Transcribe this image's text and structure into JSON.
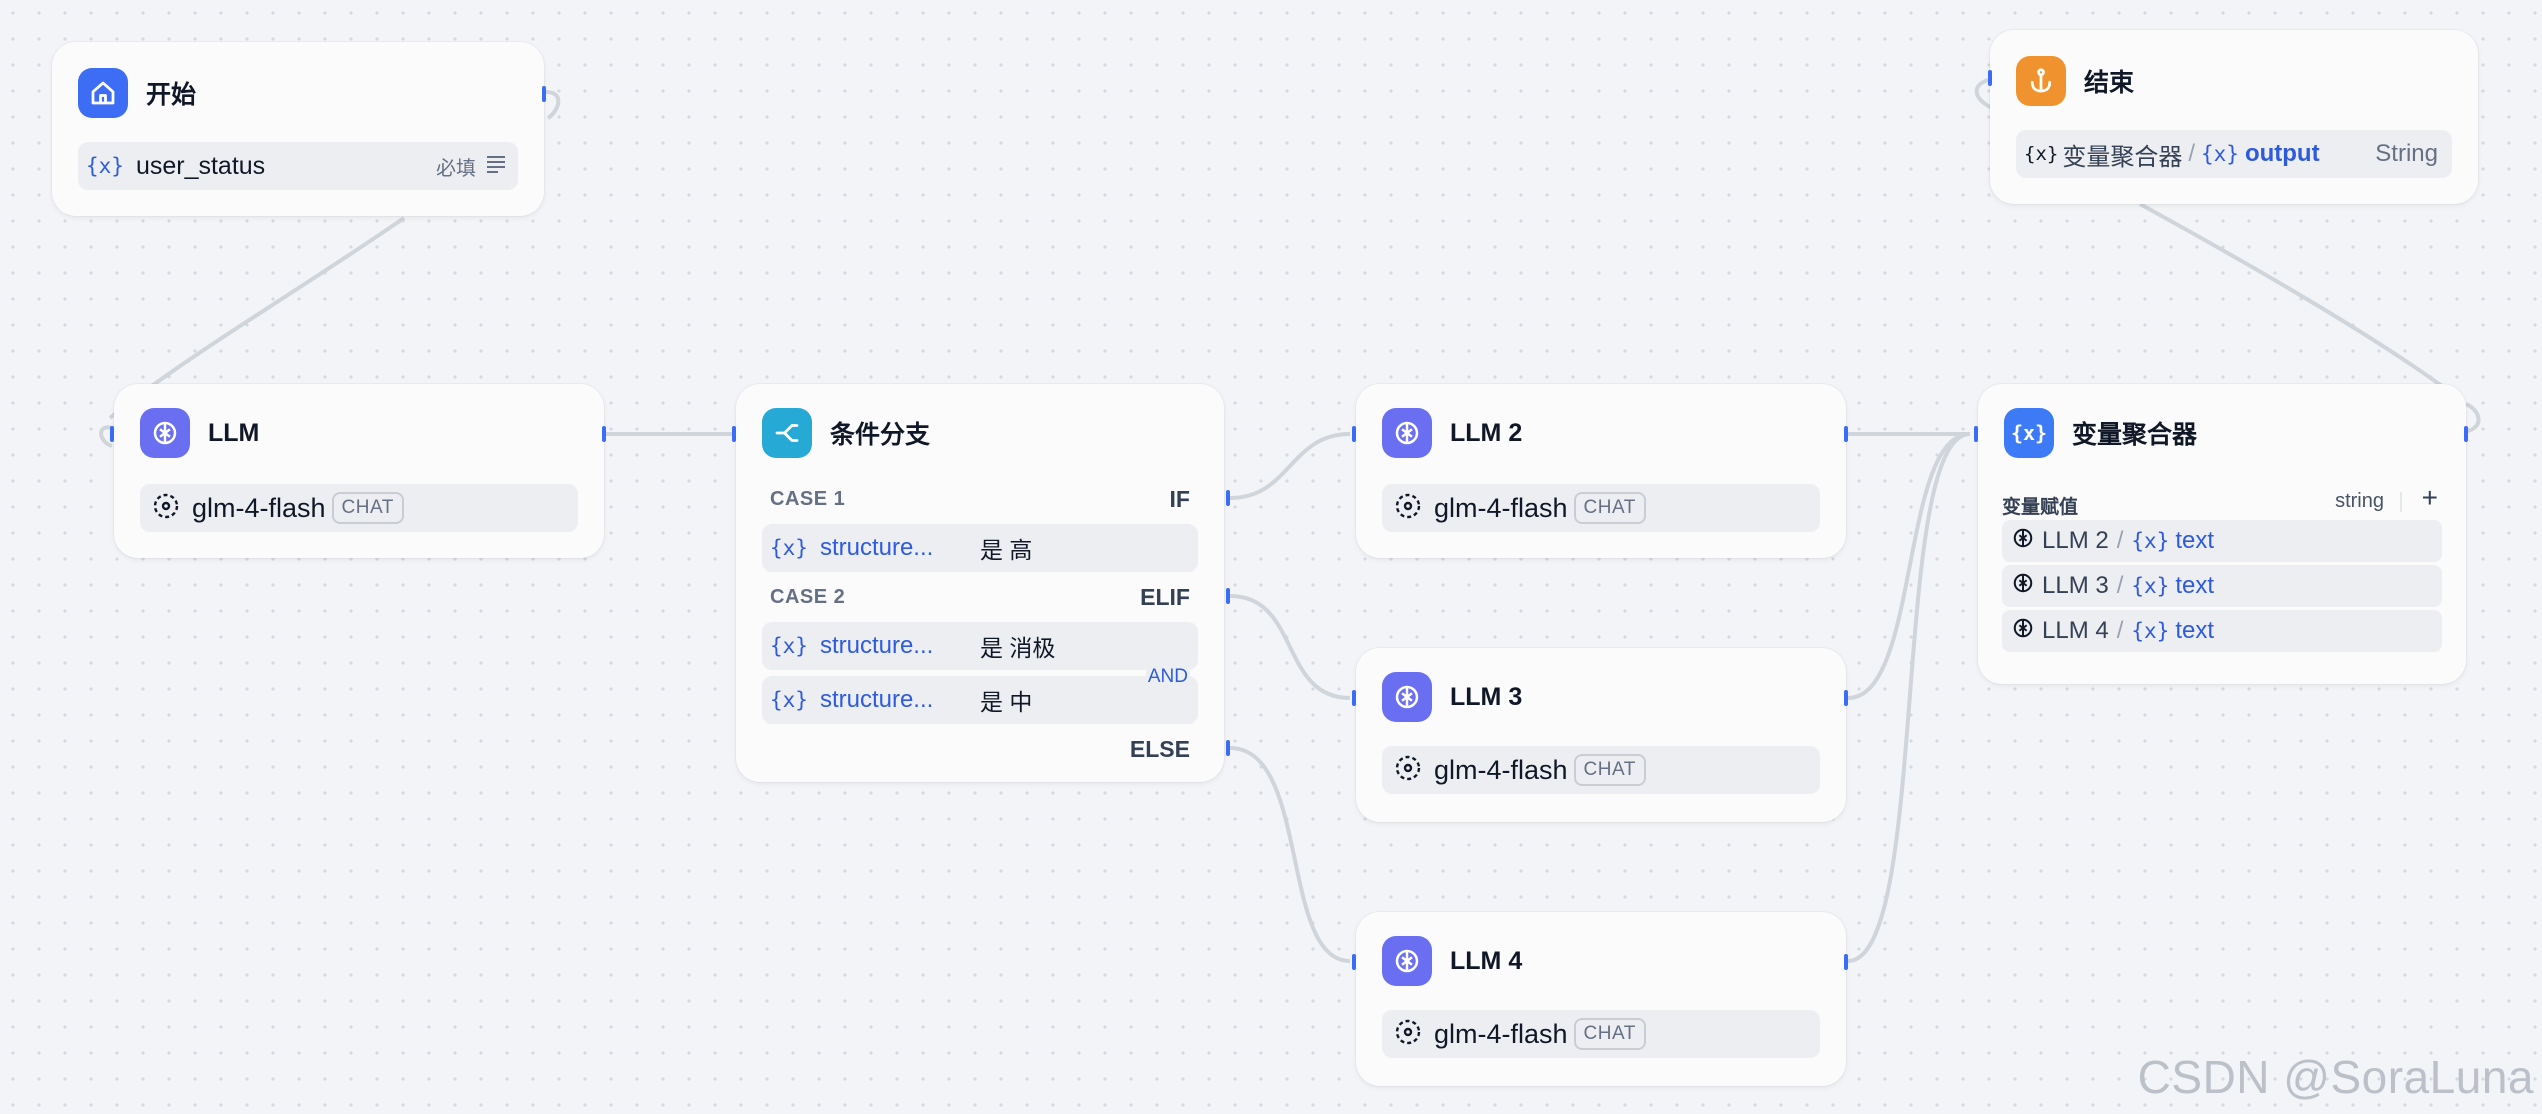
{
  "nodes": {
    "start": {
      "title": "开始",
      "variable": {
        "icon": "{x}",
        "name": "user_status",
        "required": "必填"
      }
    },
    "end": {
      "title": "结束",
      "output": {
        "source": "变量聚合器",
        "sep": "/",
        "icon": "{x}",
        "name": "output",
        "type": "String"
      }
    },
    "llm1": {
      "title": "LLM",
      "model": "glm-4-flash",
      "mode": "CHAT"
    },
    "llm2": {
      "title": "LLM 2",
      "model": "glm-4-flash",
      "mode": "CHAT"
    },
    "llm3": {
      "title": "LLM 3",
      "model": "glm-4-flash",
      "mode": "CHAT"
    },
    "llm4": {
      "title": "LLM 4",
      "model": "glm-4-flash",
      "mode": "CHAT"
    },
    "branch": {
      "title": "条件分支",
      "case1": {
        "label": "CASE 1",
        "keyword": "IF",
        "conditions": [
          {
            "icon": "{x}",
            "var": "structure...",
            "op": "是 高"
          }
        ]
      },
      "case2": {
        "label": "CASE 2",
        "keyword": "ELIF",
        "logic": "AND",
        "conditions": [
          {
            "icon": "{x}",
            "var": "structure...",
            "op": "是 消极"
          },
          {
            "icon": "{x}",
            "var": "structure...",
            "op": "是 中"
          }
        ]
      },
      "else_label": "ELSE"
    },
    "aggregator": {
      "title": "变量聚合器",
      "section_label": "变量赋值",
      "type": "string",
      "add": "+",
      "items": [
        {
          "node": "LLM 2",
          "sep": "/",
          "icon": "{x}",
          "var": "text"
        },
        {
          "node": "LLM 3",
          "sep": "/",
          "icon": "{x}",
          "var": "text"
        },
        {
          "node": "LLM 4",
          "sep": "/",
          "icon": "{x}",
          "var": "text"
        }
      ]
    }
  },
  "colors": {
    "start_icon": "#3d6df5",
    "end_icon": "#f0922e",
    "llm_icon": "#6a6ff2",
    "branch_icon": "#27a9d6",
    "aggregator_icon": "#3d7af5",
    "accent": "#2e5bdc",
    "handle": "#3b6cf6",
    "edge": "#d0d4db"
  },
  "icons": {
    "start": "home-icon",
    "end": "anchor-icon",
    "llm": "brain-icon",
    "branch": "branch-icon",
    "aggregator": "variable-icon",
    "model": "model-cube-icon",
    "required": "lines-icon"
  },
  "watermark": "CSDN @SoraLuna"
}
